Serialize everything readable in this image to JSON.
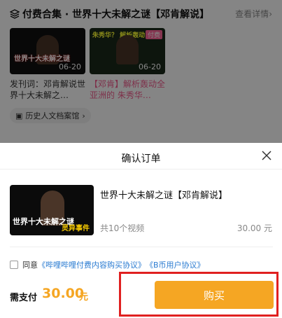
{
  "background": {
    "section_title": "付费合集 · 世界十大未解之谜【邓肯解说】",
    "detail_link": "查看详情",
    "cards": [
      {
        "thumb_text": "世界十大未解之谜",
        "duration": "06-20",
        "title": "发刊词：邓肯解说世界十大未解之…",
        "highlight": false
      },
      {
        "thumb_text": "朱秀华？ 解析轰动",
        "duration": "06-20",
        "badge": "付费",
        "title": "【邓肯】解析轰动全亚洲的 朱秀华…",
        "highlight": true
      }
    ],
    "tag_label": "历史人文档案馆"
  },
  "sheet": {
    "title": "确认订单",
    "product": {
      "thumb_text_main": "世界十大未解之谜",
      "thumb_text_sub": "灵异事件",
      "name": "世界十大未解之谜【邓肯解说】",
      "count": "共10个视频",
      "price": "30.00 元"
    },
    "agreement": {
      "prefix": "同意",
      "link1": "《哔哩哔哩付费内容购买协议》",
      "link2": "《B币用户协议》"
    },
    "pay_label": "需支付",
    "pay_amount": "30.00",
    "pay_unit": "元",
    "buy_label": "购买"
  },
  "colors": {
    "accent": "#f5a623",
    "link": "#2a7bd1",
    "highlight_text": "#f25d8e",
    "annotation_box": "#e02020"
  }
}
